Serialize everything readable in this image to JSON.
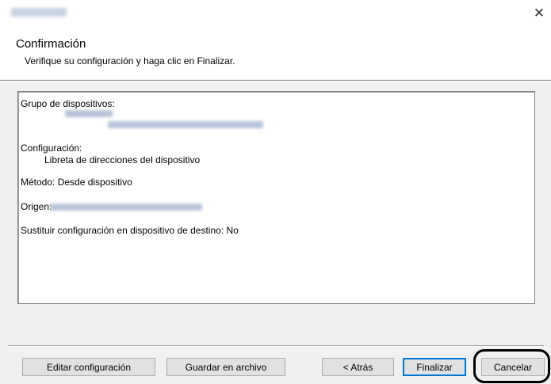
{
  "window": {
    "close_glyph": "✕"
  },
  "header": {
    "title": "Confirmación",
    "subtitle": "Verifique su configuración y haga clic en Finalizar."
  },
  "summary": {
    "device_group_label": "Grupo de dispositivos:",
    "configuration_label": "Configuración:",
    "configuration_value": "Libreta de direcciones del dispositivo",
    "method_line": "Método: Desde dispositivo",
    "origin_label": "Origen:",
    "replace_line": "Sustituir configuración en dispositivo de destino: No"
  },
  "buttons": {
    "edit": "Editar configuración",
    "save": "Guardar en archivo",
    "back": "< Atrás",
    "finish": "Finalizar",
    "cancel": "Cancelar"
  }
}
